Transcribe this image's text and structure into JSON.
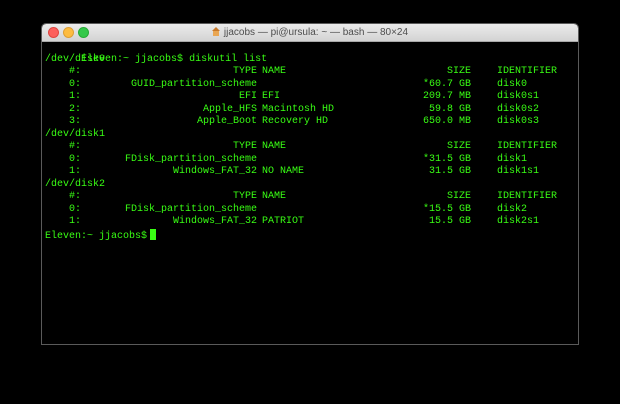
{
  "window": {
    "title": "jjacobs — pi@ursula: ~ — bash — 80×24"
  },
  "terminal": {
    "prompt": "Eleven:~ jjacobs$",
    "command": "diskutil list",
    "disks": [
      {
        "device": "/dev/disk0",
        "header": {
          "num": "#:",
          "type": "TYPE",
          "name": "NAME",
          "size": "SIZE",
          "identifier": "IDENTIFIER"
        },
        "partitions": [
          {
            "num": "0:",
            "type": "GUID_partition_scheme",
            "name": "",
            "size": "*60.7 GB",
            "identifier": "disk0"
          },
          {
            "num": "1:",
            "type": "EFI",
            "name": "EFI",
            "size": "209.7 MB",
            "identifier": "disk0s1"
          },
          {
            "num": "2:",
            "type": "Apple_HFS",
            "name": "Macintosh HD",
            "size": "59.8 GB",
            "identifier": "disk0s2"
          },
          {
            "num": "3:",
            "type": "Apple_Boot",
            "name": "Recovery HD",
            "size": "650.0 MB",
            "identifier": "disk0s3"
          }
        ]
      },
      {
        "device": "/dev/disk1",
        "header": {
          "num": "#:",
          "type": "TYPE",
          "name": "NAME",
          "size": "SIZE",
          "identifier": "IDENTIFIER"
        },
        "partitions": [
          {
            "num": "0:",
            "type": "FDisk_partition_scheme",
            "name": "",
            "size": "*31.5 GB",
            "identifier": "disk1"
          },
          {
            "num": "1:",
            "type": "Windows_FAT_32",
            "name": "NO NAME",
            "size": "31.5 GB",
            "identifier": "disk1s1"
          }
        ]
      },
      {
        "device": "/dev/disk2",
        "header": {
          "num": "#:",
          "type": "TYPE",
          "name": "NAME",
          "size": "SIZE",
          "identifier": "IDENTIFIER"
        },
        "partitions": [
          {
            "num": "0:",
            "type": "FDisk_partition_scheme",
            "name": "",
            "size": "*15.5 GB",
            "identifier": "disk2"
          },
          {
            "num": "1:",
            "type": "Windows_FAT_32",
            "name": "PATRIOT",
            "size": "15.5 GB",
            "identifier": "disk2s1"
          }
        ]
      }
    ],
    "final_prompt": "Eleven:~ jjacobs$"
  },
  "colors": {
    "terminal_text": "#39ff14",
    "terminal_background": "#000000",
    "titlebar": "#e0e0e0"
  }
}
